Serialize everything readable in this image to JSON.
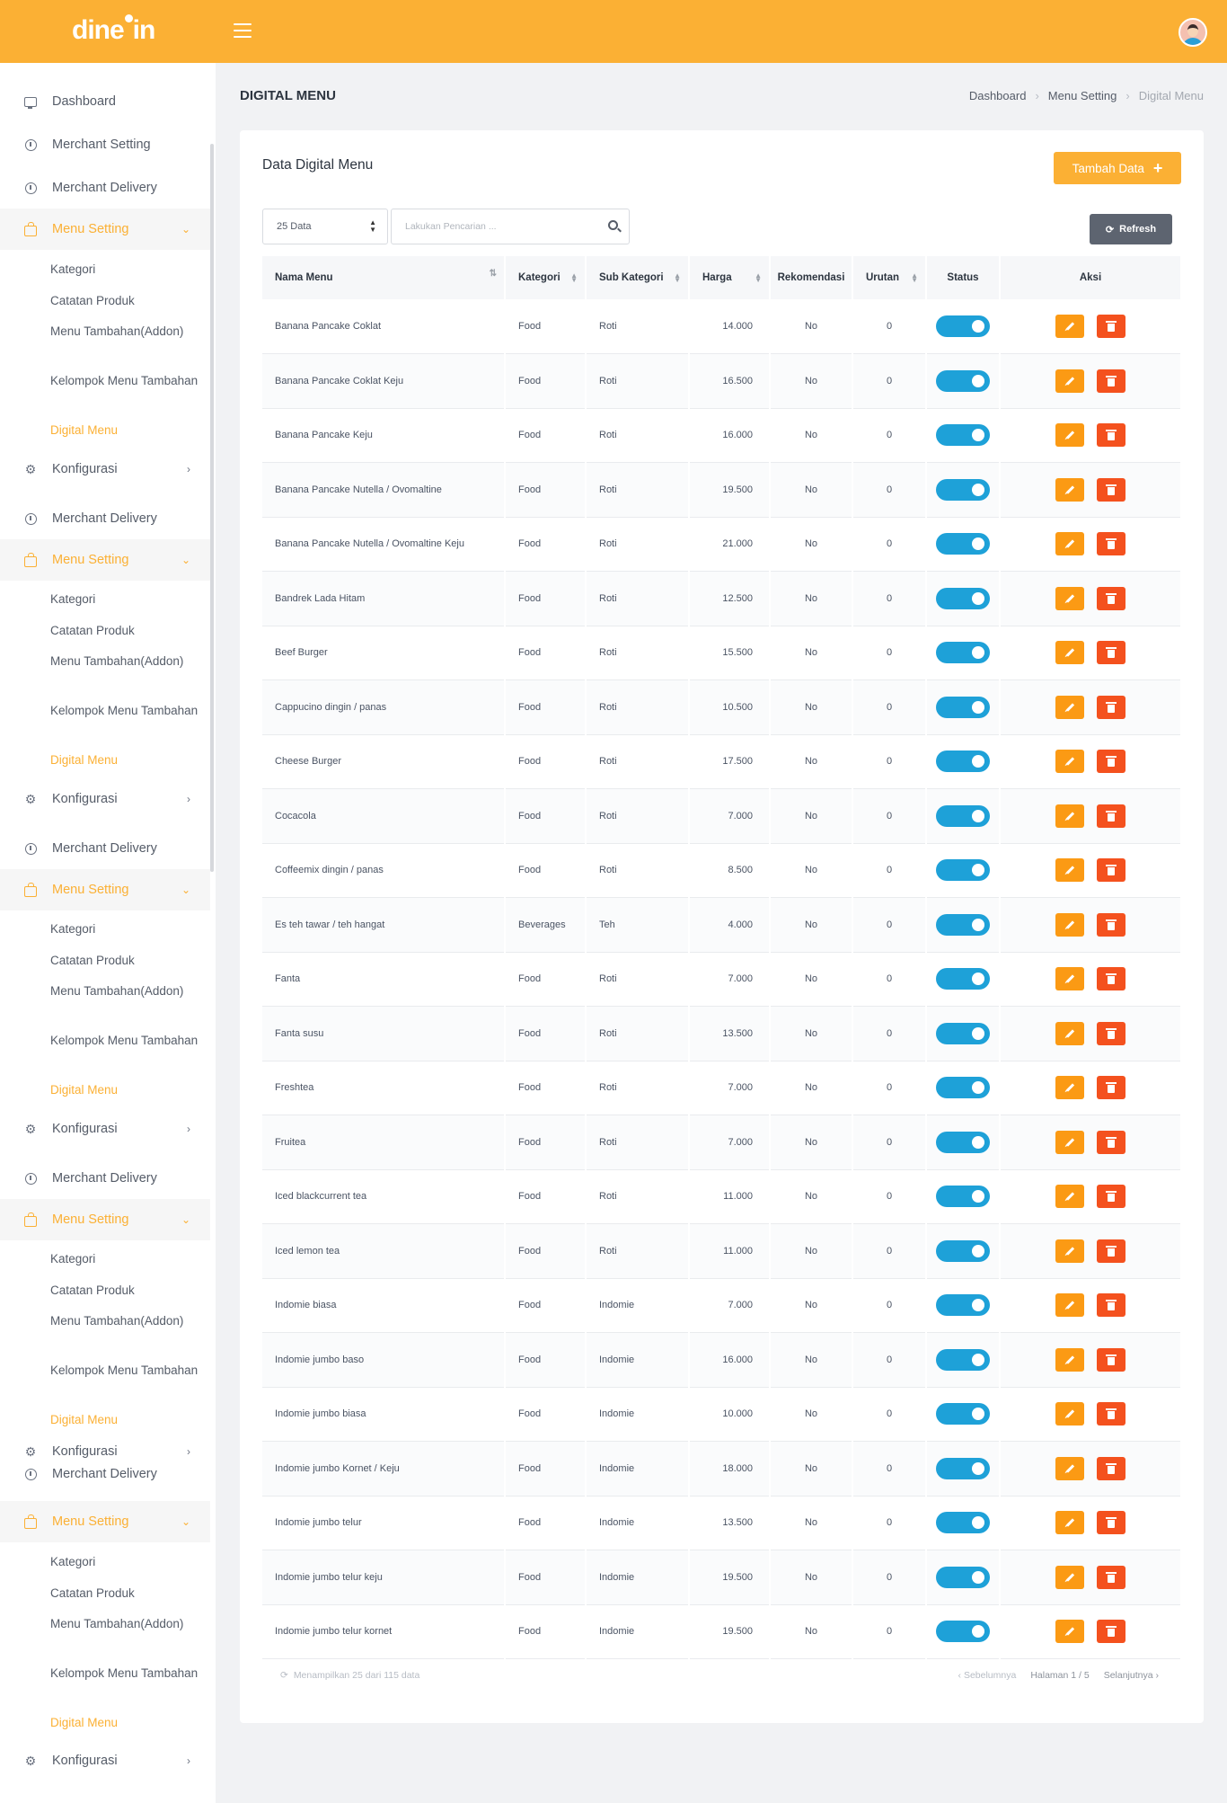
{
  "app": {
    "logo": "dine in"
  },
  "header": {
    "avatar": "avatar-icon"
  },
  "sidebar": {
    "dashboard": "Dashboard",
    "merchant_setting": "Merchant Setting",
    "merchant_delivery": "Merchant Delivery",
    "menu_setting": "Menu Setting",
    "kategori": "Kategori",
    "catatan_produk": "Catatan Produk",
    "menu_tambahan": "Menu Tambahan(Addon)",
    "kelompok_menu": "Kelompok Menu Tambahan",
    "digital_menu": "Digital Menu",
    "konfigurasi": "Konfigurasi"
  },
  "page": {
    "title": "DIGITAL MENU",
    "breadcrumb": [
      "Dashboard",
      "Menu Setting",
      "Digital Menu"
    ]
  },
  "card": {
    "title": "Data Digital Menu",
    "add_button": "Tambah Data",
    "page_size": "25 Data",
    "search_placeholder": "Lakukan Pencarian ...",
    "refresh_button": "Refresh"
  },
  "table": {
    "headers": {
      "nama": "Nama Menu",
      "kategori": "Kategori",
      "sub_kategori": "Sub Kategori",
      "harga": "Harga",
      "rekomendasi": "Rekomendasi",
      "urutan": "Urutan",
      "status": "Status",
      "aksi": "Aksi"
    },
    "rows": [
      {
        "nama": "Banana Pancake Coklat",
        "kategori": "Food",
        "sub": "Roti",
        "harga": "14.000",
        "rek": "No",
        "urutan": "0"
      },
      {
        "nama": "Banana Pancake Coklat Keju",
        "kategori": "Food",
        "sub": "Roti",
        "harga": "16.500",
        "rek": "No",
        "urutan": "0"
      },
      {
        "nama": "Banana Pancake Keju",
        "kategori": "Food",
        "sub": "Roti",
        "harga": "16.000",
        "rek": "No",
        "urutan": "0"
      },
      {
        "nama": "Banana Pancake Nutella / Ovomaltine",
        "kategori": "Food",
        "sub": "Roti",
        "harga": "19.500",
        "rek": "No",
        "urutan": "0"
      },
      {
        "nama": "Banana Pancake Nutella / Ovomaltine Keju",
        "kategori": "Food",
        "sub": "Roti",
        "harga": "21.000",
        "rek": "No",
        "urutan": "0"
      },
      {
        "nama": "Bandrek Lada Hitam",
        "kategori": "Food",
        "sub": "Roti",
        "harga": "12.500",
        "rek": "No",
        "urutan": "0"
      },
      {
        "nama": "Beef Burger",
        "kategori": "Food",
        "sub": "Roti",
        "harga": "15.500",
        "rek": "No",
        "urutan": "0"
      },
      {
        "nama": "Cappucino dingin / panas",
        "kategori": "Food",
        "sub": "Roti",
        "harga": "10.500",
        "rek": "No",
        "urutan": "0"
      },
      {
        "nama": "Cheese Burger",
        "kategori": "Food",
        "sub": "Roti",
        "harga": "17.500",
        "rek": "No",
        "urutan": "0"
      },
      {
        "nama": "Cocacola",
        "kategori": "Food",
        "sub": "Roti",
        "harga": "7.000",
        "rek": "No",
        "urutan": "0"
      },
      {
        "nama": "Coffeemix dingin / panas",
        "kategori": "Food",
        "sub": "Roti",
        "harga": "8.500",
        "rek": "No",
        "urutan": "0"
      },
      {
        "nama": "Es teh tawar / teh hangat",
        "kategori": "Beverages",
        "sub": "Teh",
        "harga": "4.000",
        "rek": "No",
        "urutan": "0"
      },
      {
        "nama": "Fanta",
        "kategori": "Food",
        "sub": "Roti",
        "harga": "7.000",
        "rek": "No",
        "urutan": "0"
      },
      {
        "nama": "Fanta susu",
        "kategori": "Food",
        "sub": "Roti",
        "harga": "13.500",
        "rek": "No",
        "urutan": "0"
      },
      {
        "nama": "Freshtea",
        "kategori": "Food",
        "sub": "Roti",
        "harga": "7.000",
        "rek": "No",
        "urutan": "0"
      },
      {
        "nama": "Fruitea",
        "kategori": "Food",
        "sub": "Roti",
        "harga": "7.000",
        "rek": "No",
        "urutan": "0"
      },
      {
        "nama": "Iced blackcurrent tea",
        "kategori": "Food",
        "sub": "Roti",
        "harga": "11.000",
        "rek": "No",
        "urutan": "0"
      },
      {
        "nama": "Iced lemon tea",
        "kategori": "Food",
        "sub": "Roti",
        "harga": "11.000",
        "rek": "No",
        "urutan": "0"
      },
      {
        "nama": "Indomie biasa",
        "kategori": "Food",
        "sub": "Indomie",
        "harga": "7.000",
        "rek": "No",
        "urutan": "0"
      },
      {
        "nama": "Indomie jumbo baso",
        "kategori": "Food",
        "sub": "Indomie",
        "harga": "16.000",
        "rek": "No",
        "urutan": "0"
      },
      {
        "nama": "Indomie jumbo biasa",
        "kategori": "Food",
        "sub": "Indomie",
        "harga": "10.000",
        "rek": "No",
        "urutan": "0"
      },
      {
        "nama": "Indomie jumbo Kornet / Keju",
        "kategori": "Food",
        "sub": "Indomie",
        "harga": "18.000",
        "rek": "No",
        "urutan": "0"
      },
      {
        "nama": "Indomie jumbo telur",
        "kategori": "Food",
        "sub": "Indomie",
        "harga": "13.500",
        "rek": "No",
        "urutan": "0"
      },
      {
        "nama": "Indomie jumbo telur keju",
        "kategori": "Food",
        "sub": "Indomie",
        "harga": "19.500",
        "rek": "No",
        "urutan": "0"
      },
      {
        "nama": "Indomie jumbo telur kornet",
        "kategori": "Food",
        "sub": "Indomie",
        "harga": "19.500",
        "rek": "No",
        "urutan": "0"
      }
    ]
  },
  "footer": {
    "info": "Menampilkan 25 dari 115 data",
    "prev": "Sebelumnya",
    "page": "Halaman 1 / 5",
    "next": "Selanjutnya"
  },
  "colors": {
    "accent": "#fbb034",
    "toggle": "#1ea1d8",
    "edit": "#fb9a14",
    "delete": "#f4511e"
  }
}
